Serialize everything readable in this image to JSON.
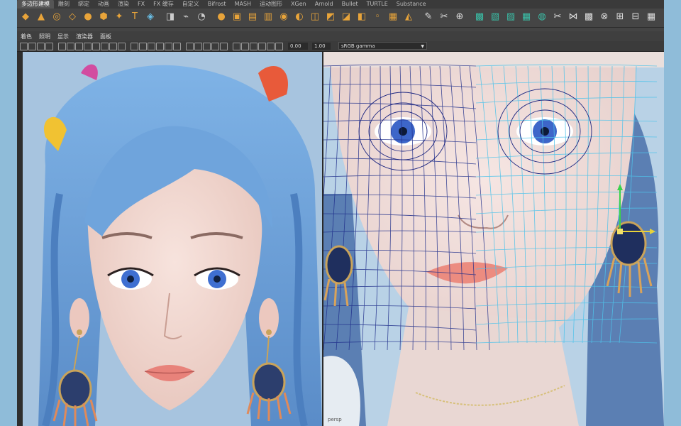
{
  "shelf_tabs": [
    "多边形建模",
    "雕刻",
    "绑定",
    "动画",
    "渲染",
    "FX",
    "FX 缓存",
    "自定义",
    "Bifrost",
    "MASH",
    "运动图形",
    "XGen",
    "Arnold",
    "Bullet",
    "TURTLE",
    "Substance"
  ],
  "shelf_icons": [
    "cube-icon",
    "cone-icon",
    "torus-icon",
    "plane-icon",
    "disc-icon",
    "platonic-icon",
    "star-icon",
    "text-icon",
    "svg-icon",
    "group-icon",
    "path-icon",
    "flow-icon",
    "sphere-icon",
    "combine-icon",
    "separate-icon",
    "extract-icon",
    "smooth-icon",
    "boolean-icon",
    "mirror-icon",
    "bevel-icon",
    "bridge-icon",
    "extrude-icon",
    "merge-icon",
    "fill-icon",
    "wedge-icon",
    "pen-icon",
    "multicut-icon",
    "target-weld-icon",
    "uv-icon",
    "layout-icon",
    "unfold-icon",
    "planar-icon",
    "automatic-icon",
    "cut-uv-icon",
    "sew-icon",
    "checker-icon",
    "pin-icon",
    "snap-icon",
    "distribute-icon",
    "grid-icon"
  ],
  "panel_menu": [
    "着色",
    "照明",
    "显示",
    "渲染器",
    "面板"
  ],
  "panel_toolbar": {
    "exposure": "0.00",
    "gamma": "1.00",
    "colorspace": "sRGB gamma"
  },
  "right_pane_label": "persp"
}
